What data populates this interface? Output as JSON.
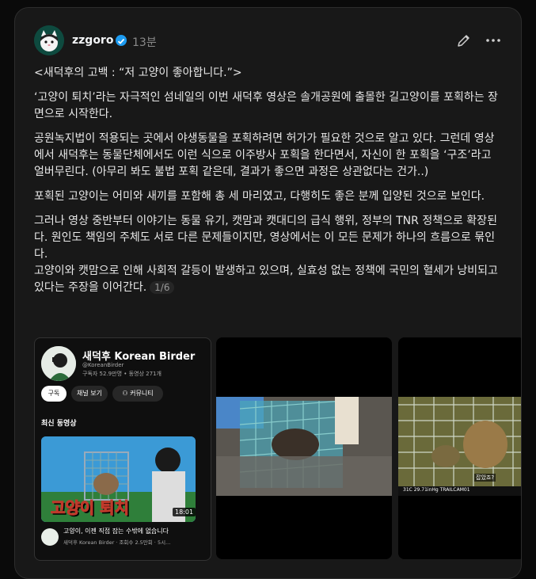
{
  "post": {
    "author": "zzgoro",
    "time": "13분",
    "paragraphs": [
      "<새덕후의 고백 : “저 고양이 좋아합니다.”>",
      "‘고양이 퇴치’라는 자극적인 섬네일의 이번 새덕후 영상은 솔개공원에 출몰한 길고양이를 포획하는 장면으로 시작한다.",
      "공원녹지법이 적용되는 곳에서 야생동물을 포획하려면 허가가 필요한 것으로 알고 있다. 그런데 영상에서 새덕후는 동물단체에서도 이런 식으로 이주방사 포획을 한다면서, 자신이 한 포획을 ‘구조’라고 얼버무린다. (아무리 봐도 불법 포획 같은데, 결과가 좋으면 과정은 상관없다는 건가..)",
      "포획된 고양이는 어미와 새끼를 포함해 총 세 마리였고, 다행히도 좋은 분께 입양된 것으로 보인다.",
      "그러나 영상 중반부터 이야기는 동물 유기, 캣맘과 캣대디의 급식 행위, 정부의 TNR 정책으로 확장된다. 원인도 책임의 주체도 서로 다른 문제들이지만, 영상에서는 이 모든 문제가 하나의 흐름으로 묶인다.\n고양이와 캣맘으로 인해 사회적 갈등이 발생하고 있으며, 실효성 없는 정책에 국민의 혈세가 낭비되고 있다는 주장을 이어간다."
    ],
    "counter": "1/6"
  },
  "media1": {
    "channel_name": "새덕후 Korean Birder",
    "handle": "@KoreanBirder",
    "subs": "구독자 52.9만명 • 동영상 271개",
    "chip_subscribe": "구독",
    "chip_channel": "채널 보기",
    "chip_community": "커뮤니티",
    "latest": "최신 동영상",
    "thumb_title": "고양이 퇴치",
    "duration": "18:01",
    "video_title": "고양이, 이젠 직접 잡는 수밖에 없습니다",
    "video_meta": "새덕후 Korean Birder · 조회수 2.5만회 · 5시..."
  },
  "media3": {
    "overlay": "잡았죠?",
    "cam": "31C 29.71inHg  TRAILCAM01"
  },
  "colors": {
    "verified": "#1d9bf0",
    "accent": "#c0392b"
  }
}
